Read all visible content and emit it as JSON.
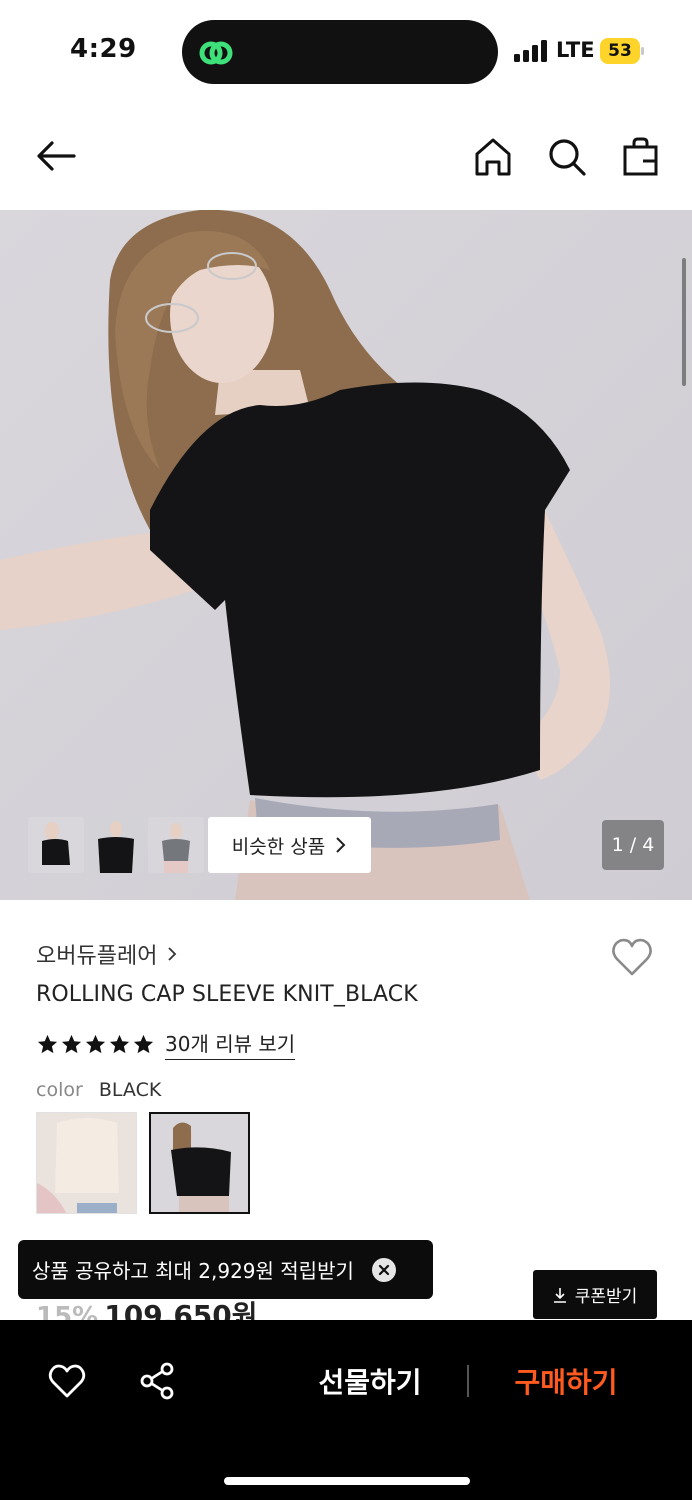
{
  "status_bar": {
    "time": "4:29",
    "network": "LTE",
    "battery": "53",
    "battery_color": "#ffd42a"
  },
  "top_nav": {
    "icons": [
      "back-arrow-icon",
      "home-icon",
      "search-icon",
      "shopping-bag-icon"
    ]
  },
  "hero": {
    "similar_label": "비슷한 상품",
    "pager": "1 / 4"
  },
  "product": {
    "brand": "오버듀플레어",
    "title": "ROLLING CAP SLEEVE KNIT_BLACK",
    "rating_stars": 5,
    "review_link": "30개 리뷰 보기",
    "color_label": "color",
    "color_value": "BLACK",
    "discount": "15%",
    "price": "109,650원"
  },
  "toast": {
    "text": "상품 공유하고 최대 2,929원 적립받기"
  },
  "coupon": {
    "label": "쿠폰받기"
  },
  "bottom_bar": {
    "gift_label": "선물하기",
    "buy_label": "구매하기",
    "buy_color": "#ff5a1f"
  }
}
